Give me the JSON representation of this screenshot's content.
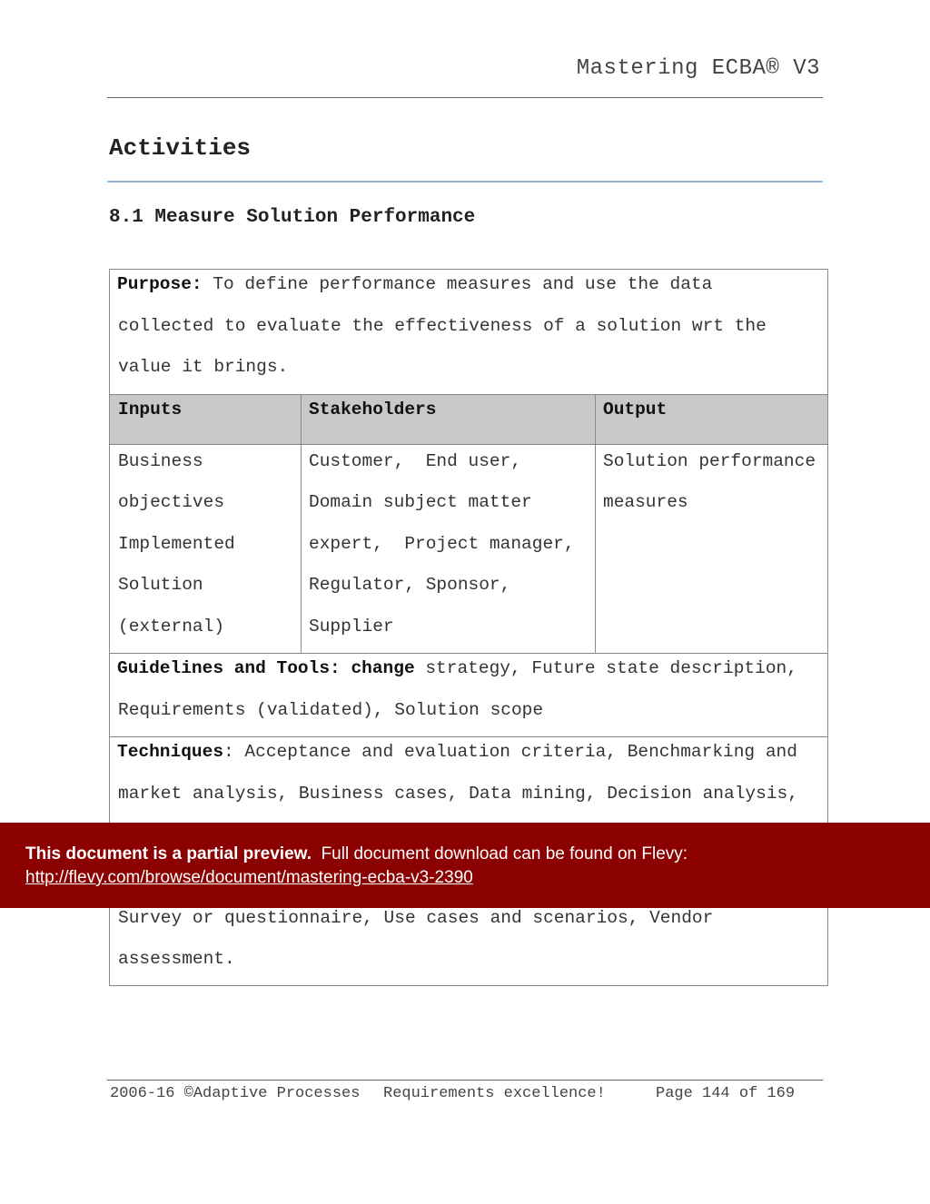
{
  "header": {
    "title": "Mastering ECBA® V3"
  },
  "section_title": "Activities",
  "subsection_title": "8.1 Measure Solution Performance",
  "table": {
    "purpose_label": "Purpose:",
    "purpose_lines": [
      " To define performance measures and use the data",
      "collected to evaluate the effectiveness of a solution wrt the",
      "value it brings."
    ],
    "headers": [
      "Inputs",
      "Stakeholders",
      "Output"
    ],
    "inputs_lines": [
      "Business",
      "objectives",
      "Implemented",
      "Solution",
      "(external)"
    ],
    "stakeholders_lines": [
      "Customer,  End user,",
      "Domain subject matter",
      "expert,  Project manager,",
      "Regulator, Sponsor,",
      "Supplier"
    ],
    "output_lines": [
      "Solution performance",
      "measures"
    ],
    "guidelines_label": "Guidelines and Tools: change",
    "guidelines_lines": [
      " strategy, Future state description,",
      "Requirements (validated), Solution scope"
    ],
    "techniques_label": "Techniques",
    "techniques_lines": [
      ": Acceptance and evaluation criteria, Benchmarking and",
      "market analysis, Business cases, Data mining, Decision analysis,",
      "Survey or questionnaire, Use cases and scenarios, Vendor",
      "assessment."
    ]
  },
  "banner": {
    "bold": "This document is a partial preview.",
    "text": "Full document download can be found on Flevy:",
    "link": "http://flevy.com/browse/document/mastering-ecba-v3-2390",
    "color": "#8b0000"
  },
  "footer": {
    "copyright": "2006-16 ©Adaptive Processes",
    "tagline": "Requirements excellence!",
    "page": "Page 144 of 169"
  }
}
